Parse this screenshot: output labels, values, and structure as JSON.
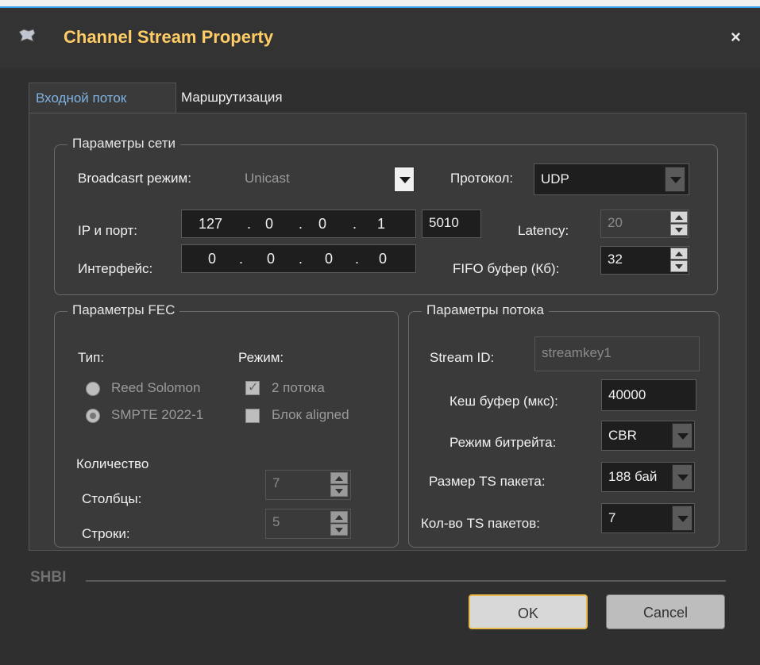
{
  "window": {
    "title": "Channel Stream Property",
    "close_label": "×"
  },
  "tabs": [
    {
      "label": "Входной поток"
    },
    {
      "label": "Маршрутизация"
    }
  ],
  "net": {
    "title": "Параметры сети",
    "broadcast_label": "Broadcasrt режим:",
    "broadcast_value": "Unicast",
    "protocol_label": "Протокол:",
    "protocol_value": "UDP",
    "ip_label": "IP и порт:",
    "ip": [
      "127",
      "0",
      "0",
      "1"
    ],
    "port": "5010",
    "latency_label": "Latency:",
    "latency_value": "20",
    "iface_label": "Интерфейс:",
    "iface": [
      "0",
      "0",
      "0",
      "0"
    ],
    "fifo_label": "FIFO буфер (Кб):",
    "fifo_value": "32"
  },
  "fec": {
    "title": "Параметры FEC",
    "type_label": "Тип:",
    "mode_label": "Режим:",
    "reed": "Reed Solomon",
    "smpte": "SMPTE 2022-1",
    "streams2": "2 потока",
    "block": "Блок aligned",
    "count_label": "Количество",
    "cols_label": "Столбцы:",
    "cols_value": "7",
    "rows_label": "Строки:",
    "rows_value": "5"
  },
  "stream": {
    "title": "Параметры потока",
    "id_label": "Stream ID:",
    "id_value": "streamkey1",
    "cache_label": "Кеш буфер (мкс):",
    "cache_value": "40000",
    "bitrate_label": "Режим битрейта:",
    "bitrate_value": "CBR",
    "ts_size_label": "Размер TS пакета:",
    "ts_size_value": "188 бай",
    "ts_count_label": "Кол-во TS пакетов:",
    "ts_count_value": "7"
  },
  "footer": {
    "brand": "SHBI",
    "ok": "OK",
    "cancel": "Cancel"
  }
}
